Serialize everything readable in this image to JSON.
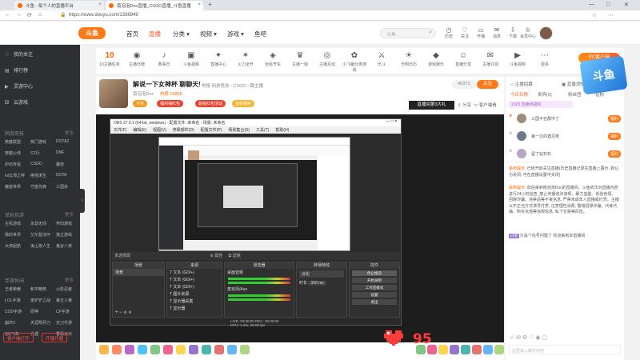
{
  "browser": {
    "tabs": [
      {
        "title": "斗鱼 - 每个人的直播平台"
      },
      {
        "title": "南泡泡Doc直播_CSGO直播_斗鱼直播"
      }
    ],
    "url": "https://www.douyu.com/1336849",
    "win_controls": [
      "—",
      "□",
      "✕"
    ]
  },
  "header": {
    "logo": "斗鱼",
    "nav": [
      "首页",
      "直播",
      "分类",
      "视频",
      "游戏",
      "鱼吧"
    ],
    "active_nav": "直播",
    "search_placeholder": "斗鱼",
    "icons": [
      {
        "name": "history-icon",
        "label": "历史"
      },
      {
        "name": "follow-icon",
        "label": "关注"
      },
      {
        "name": "live-icon",
        "label": "开播"
      },
      {
        "name": "message-icon",
        "label": "消息"
      },
      {
        "name": "download-icon",
        "label": "下载"
      },
      {
        "name": "more-icon",
        "label": "会员中心"
      }
    ]
  },
  "sidebar": {
    "items": [
      {
        "icon": "heart-icon",
        "label": "我的关注"
      },
      {
        "icon": "rank-icon",
        "label": "排行榜"
      },
      {
        "icon": "video-icon",
        "label": "灵游中心"
      },
      {
        "icon": "game-icon",
        "label": "云游戏"
      }
    ],
    "sections": [
      {
        "title": "网游竞技",
        "more": "更多",
        "games": [
          "英雄联盟",
          "热门游戏",
          "DOTA2",
          "穿越火线",
          "CF行",
          "DNF",
          "炉石传说",
          "CSGO",
          "魔兽",
          "lol云顶之弈",
          "绝地求生",
          "DOTA",
          "魔兽世界",
          "守望先锋",
          "三国杀"
        ]
      },
      {
        "title": "单机热游",
        "more": "更多",
        "games": [
          "主机游戏",
          "永劫无间",
          "怀旧游戏",
          "我的世界",
          "艾尔登法环",
          "独立游戏",
          "大侠起航",
          "海上故人生",
          "鬼谷八荒"
        ]
      },
      {
        "title": "手游休闲",
        "more": "更多",
        "games": [
          "王者荣耀",
          "和平精英",
          "火影忍者",
          "LOL手游",
          "金铲铲之战",
          "第五人格",
          "COD手游",
          "原神",
          "CF手游",
          "崩坏3",
          "天涯明月刀",
          "天刀手游",
          "QQ飞车",
          "光遇",
          "香肠派对"
        ]
      }
    ],
    "buttons": [
      "客户端打开",
      "开播开播"
    ]
  },
  "categories": {
    "items": [
      {
        "label": "10主播任务",
        "glyph": "10"
      },
      {
        "label": "主播日榜",
        "glyph": "◉"
      },
      {
        "label": "赛事日",
        "glyph": "♪"
      },
      {
        "label": "斗鱼视频",
        "glyph": "▣"
      },
      {
        "label": "直播中心",
        "glyph": "✦"
      },
      {
        "label": "火力全开",
        "glyph": "✶"
      },
      {
        "label": "全民开车",
        "glyph": "◈"
      },
      {
        "label": "主播一姐",
        "glyph": "♛"
      },
      {
        "label": "主播互动",
        "glyph": "◎"
      },
      {
        "label": "小飞猪分类游戏",
        "glyph": "✿"
      },
      {
        "label": "乐斗",
        "glyph": "⚔"
      },
      {
        "label": "光明日历",
        "glyph": "☀"
      },
      {
        "label": "游戏娱乐",
        "glyph": "◆"
      },
      {
        "label": "直播分享",
        "glyph": "☺"
      },
      {
        "label": "主播订阅",
        "glyph": "✉"
      },
      {
        "label": "斗鱼视频",
        "glyph": "▶"
      },
      {
        "label": "更多",
        "glyph": "⋯"
      }
    ],
    "pc_button": "PC客户端"
  },
  "room": {
    "title": "解说一下女神杯 聊聊天!",
    "meta": "举报  网游竞技 › CSGO › 跟主播",
    "streamer": "南泡泡Doc",
    "hot": "热度 16855",
    "tags": [
      {
        "label": "讨论",
        "color": "#f59a23"
      },
      {
        "label": "福利抽红包",
        "color": "#e8432e"
      },
      {
        "label": "超级红包活动",
        "color": "#e8432e"
      },
      {
        "label": "鱼粉福利",
        "color": "#f5b52e"
      }
    ],
    "fans": "40372",
    "follow": "关注",
    "tools": [
      "分享",
      "客户端看"
    ],
    "banner": "直播间第3大礼"
  },
  "obs": {
    "title": "OBS 27.0.1 (64-bit, windows) - 配置文件: 未命名 - 场景: 未命名",
    "menu": [
      "文件(F)",
      "编辑(E)",
      "视图(V)",
      "停靠部件(D)",
      "配置文件(P)",
      "场景集合(S)",
      "工具(T)",
      "帮助(H)"
    ],
    "panels": {
      "scenes": {
        "title": "场景",
        "items": [
          "场景"
        ]
      },
      "sources": {
        "title": "来源",
        "items": [
          "文本 (GDI+)",
          "文本 (GDI+)",
          "文本 (GDI+)",
          "图片来源",
          "显示器采集",
          "显示器"
        ]
      },
      "mixer": {
        "title": "混音器",
        "items": [
          "桌面音频",
          "麦克风/Aux"
        ]
      },
      "transitions": {
        "title": "转场特效",
        "mode": "淡化",
        "duration_label": "时长",
        "duration": "300 ms"
      },
      "controls": {
        "title": "控件",
        "buttons": [
          "停止推流",
          "开始录制",
          "工作室模式",
          "设置",
          "退出"
        ]
      }
    },
    "status": "LIVE: 00:00:00   REC: 00:00:00   CPU: 1.1%, 60.00 fps"
  },
  "chat": {
    "tabs": [
      "今日日榜",
      "贵宾(0)",
      "粉丝团",
      "钻粉"
    ],
    "top_tags": [
      "主播招募",
      "直播须知"
    ],
    "notice": "2023 直播间福利",
    "ranks": [
      {
        "name": "三国不在群中了",
        "tag": "福利"
      },
      {
        "name": "每一次的遇见呢",
        "tag": "福利"
      },
      {
        "name": "留了钻石石",
        "tag": "福利"
      }
    ],
    "messages": [
      {
        "prefix": "系统提示:",
        "text": "已经开启关注直播(历史直播记录在直播上展示, 默认为关闭, 可在直播设置中关闭)"
      },
      {
        "prefix": "系统提示:",
        "text": "欢迎来到南泡泡Doc的直播间。斗鱼依法对直播内容进行24小时巡查, 禁止传播违法违规、暴力血腥、低俗色情、招嫖诈骗、违禁品等不良信息, 严禁未成年人直播或打赏。主播以不正当方式诱导打赏, 注意理性消费, 警惕招嫖诈骗、代练代抽、购买充值等违规信息, 私下交易等风险。"
      },
      {
        "prefix": "LV8",
        "text": "只是个信号问题了 欢迎来到本直播间"
      }
    ],
    "input_placeholder": "这里输入聊天内容"
  },
  "overlay": {
    "counter": "95",
    "side_logo": "斗鱼"
  }
}
